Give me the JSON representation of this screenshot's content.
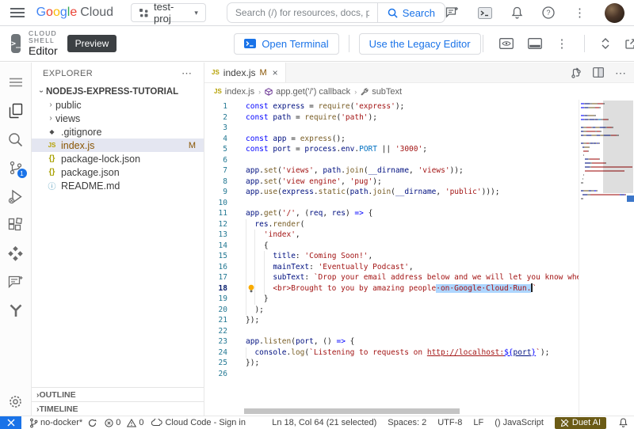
{
  "colors": {
    "accent_blue": "#1a73e8",
    "selection": "#add6ff",
    "git_modified": "#895503",
    "duet_badge_bg": "#6b5b16",
    "remote_indicator_bg": "#1a73e8",
    "preview_badge_bg": "#3c4043"
  },
  "topbar": {
    "brand_letters": [
      "G",
      "o",
      "o",
      "g",
      "l",
      "e"
    ],
    "brand_suffix": "Cloud",
    "project_name": "test-proj",
    "project_caret": "▾",
    "search_placeholder": "Search (/) for resources, docs, products, ...",
    "search_button_label": "Search",
    "more_glyph": "⋮"
  },
  "shell_header": {
    "eyebrow": "CLOUD SHELL",
    "title": "Editor",
    "shell_logo_glyph": ">_",
    "preview_badge": "Preview",
    "open_terminal_label": "Open Terminal",
    "legacy_editor_label": "Use the Legacy Editor",
    "more_glyph": "⋮",
    "close_glyph": "×"
  },
  "activity_bar": {
    "scm_badge": "1"
  },
  "sidebar": {
    "explorer_title": "EXPLORER",
    "more_glyph": "⋯",
    "root_label": "NODEJS-EXPRESS-TUTORIAL",
    "files": [
      {
        "label": "public"
      },
      {
        "label": "views"
      },
      {
        "label": ".gitignore",
        "glyph": "◆"
      },
      {
        "label": "index.js",
        "glyph": "JS",
        "badge": "M"
      },
      {
        "label": "package-lock.json",
        "glyph": "{}"
      },
      {
        "label": "package.json",
        "glyph": "{}"
      },
      {
        "label": "README.md",
        "glyph": "ⓘ"
      }
    ],
    "outline_label": "OUTLINE",
    "timeline_label": "TIMELINE"
  },
  "editor": {
    "tab": {
      "label": "index.js",
      "glyph": "JS",
      "modified": "M",
      "close_glyph": "×"
    },
    "tabbar_more_glyph": "⋯",
    "breadcrumb": {
      "file": "index.js",
      "file_glyph": "JS",
      "symbol": "app.get('/') callback",
      "member": "subText"
    },
    "code": {
      "lines": [
        {
          "n": 1,
          "ind": 0,
          "seg": [
            [
              "const",
              "kw"
            ],
            [
              " ",
              "pln"
            ],
            [
              "express",
              "var"
            ],
            [
              " = ",
              "pln"
            ],
            [
              "require",
              "fn"
            ],
            [
              "(",
              "pln"
            ],
            [
              "'express'",
              "str"
            ],
            [
              ");",
              "pln"
            ]
          ]
        },
        {
          "n": 2,
          "ind": 0,
          "seg": [
            [
              "const",
              "kw"
            ],
            [
              " ",
              "pln"
            ],
            [
              "path",
              "var"
            ],
            [
              " = ",
              "pln"
            ],
            [
              "require",
              "fn"
            ],
            [
              "(",
              "pln"
            ],
            [
              "'path'",
              "str"
            ],
            [
              ");",
              "pln"
            ]
          ]
        },
        {
          "n": 3,
          "ind": 0,
          "seg": []
        },
        {
          "n": 4,
          "ind": 0,
          "seg": [
            [
              "const",
              "kw"
            ],
            [
              " ",
              "pln"
            ],
            [
              "app",
              "var"
            ],
            [
              " = ",
              "pln"
            ],
            [
              "express",
              "fn"
            ],
            [
              "();",
              "pln"
            ]
          ]
        },
        {
          "n": 5,
          "ind": 0,
          "seg": [
            [
              "const",
              "kw"
            ],
            [
              " ",
              "pln"
            ],
            [
              "port",
              "var"
            ],
            [
              " = ",
              "pln"
            ],
            [
              "process",
              "var"
            ],
            [
              ".",
              "pln"
            ],
            [
              "env",
              "var"
            ],
            [
              ".",
              "pln"
            ],
            [
              "PORT",
              "cnst"
            ],
            [
              " || ",
              "pln"
            ],
            [
              "'3000'",
              "str"
            ],
            [
              ";",
              "pln"
            ]
          ]
        },
        {
          "n": 6,
          "ind": 0,
          "seg": []
        },
        {
          "n": 7,
          "ind": 0,
          "seg": [
            [
              "app",
              "var"
            ],
            [
              ".",
              "pln"
            ],
            [
              "set",
              "fn"
            ],
            [
              "(",
              "pln"
            ],
            [
              "'views'",
              "str"
            ],
            [
              ", ",
              "pln"
            ],
            [
              "path",
              "var"
            ],
            [
              ".",
              "pln"
            ],
            [
              "join",
              "fn"
            ],
            [
              "(",
              "pln"
            ],
            [
              "__dirname",
              "var"
            ],
            [
              ", ",
              "pln"
            ],
            [
              "'views'",
              "str"
            ],
            [
              "));",
              "pln"
            ]
          ]
        },
        {
          "n": 8,
          "ind": 0,
          "seg": [
            [
              "app",
              "var"
            ],
            [
              ".",
              "pln"
            ],
            [
              "set",
              "fn"
            ],
            [
              "(",
              "pln"
            ],
            [
              "'view engine'",
              "str"
            ],
            [
              ", ",
              "pln"
            ],
            [
              "'pug'",
              "str"
            ],
            [
              ");",
              "pln"
            ]
          ]
        },
        {
          "n": 9,
          "ind": 0,
          "seg": [
            [
              "app",
              "var"
            ],
            [
              ".",
              "pln"
            ],
            [
              "use",
              "fn"
            ],
            [
              "(",
              "pln"
            ],
            [
              "express",
              "var"
            ],
            [
              ".",
              "pln"
            ],
            [
              "static",
              "fn"
            ],
            [
              "(",
              "pln"
            ],
            [
              "path",
              "var"
            ],
            [
              ".",
              "pln"
            ],
            [
              "join",
              "fn"
            ],
            [
              "(",
              "pln"
            ],
            [
              "__dirname",
              "var"
            ],
            [
              ", ",
              "pln"
            ],
            [
              "'public'",
              "str"
            ],
            [
              ")));",
              "pln"
            ]
          ]
        },
        {
          "n": 10,
          "ind": 0,
          "seg": []
        },
        {
          "n": 11,
          "ind": 0,
          "seg": [
            [
              "app",
              "var"
            ],
            [
              ".",
              "pln"
            ],
            [
              "get",
              "fn"
            ],
            [
              "(",
              "pln"
            ],
            [
              "'/'",
              "str"
            ],
            [
              ", (",
              "pln"
            ],
            [
              "req",
              "var"
            ],
            [
              ", ",
              "pln"
            ],
            [
              "res",
              "var"
            ],
            [
              ") ",
              "pln"
            ],
            [
              "=>",
              "kw"
            ],
            [
              " {",
              "pln"
            ]
          ]
        },
        {
          "n": 12,
          "ind": 2,
          "seg": [
            [
              "res",
              "var"
            ],
            [
              ".",
              "pln"
            ],
            [
              "render",
              "fn"
            ],
            [
              "(",
              "pln"
            ]
          ]
        },
        {
          "n": 13,
          "ind": 4,
          "seg": [
            [
              "'index'",
              "str"
            ],
            [
              ",",
              "pln"
            ]
          ]
        },
        {
          "n": 14,
          "ind": 4,
          "seg": [
            [
              "{",
              "pln"
            ]
          ]
        },
        {
          "n": 15,
          "ind": 6,
          "seg": [
            [
              "title",
              "var"
            ],
            [
              ": ",
              "pln"
            ],
            [
              "'Coming Soon!'",
              "str"
            ],
            [
              ",",
              "pln"
            ]
          ]
        },
        {
          "n": 16,
          "ind": 6,
          "seg": [
            [
              "mainText",
              "var"
            ],
            [
              ": ",
              "pln"
            ],
            [
              "'Eventually Podcast'",
              "str"
            ],
            [
              ",",
              "pln"
            ]
          ]
        },
        {
          "n": 17,
          "ind": 6,
          "seg": [
            [
              "subText",
              "var"
            ],
            [
              ": ",
              "pln"
            ],
            [
              "`Drop your email address below and we will let you know when w",
              "str"
            ]
          ]
        },
        {
          "n": 18,
          "ind": 6,
          "active": true,
          "bulb": true,
          "seg": [
            [
              "<br>Brought to you by amazing people",
              "str"
            ],
            [
              " on Google Cloud Run.",
              "str sel ws"
            ],
            [
              "",
              "cursor"
            ],
            [
              "`",
              "str"
            ]
          ]
        },
        {
          "n": 19,
          "ind": 4,
          "seg": [
            [
              "}",
              "pln"
            ]
          ]
        },
        {
          "n": 20,
          "ind": 2,
          "seg": [
            [
              ");",
              "pln"
            ]
          ]
        },
        {
          "n": 21,
          "ind": 0,
          "seg": [
            [
              "});",
              "pln"
            ]
          ]
        },
        {
          "n": 22,
          "ind": 0,
          "seg": []
        },
        {
          "n": 23,
          "ind": 0,
          "seg": [
            [
              "app",
              "var"
            ],
            [
              ".",
              "pln"
            ],
            [
              "listen",
              "fn"
            ],
            [
              "(",
              "pln"
            ],
            [
              "port",
              "var"
            ],
            [
              ", () ",
              "pln"
            ],
            [
              "=>",
              "kw"
            ],
            [
              " {",
              "pln"
            ]
          ]
        },
        {
          "n": 24,
          "ind": 2,
          "seg": [
            [
              "console",
              "var"
            ],
            [
              ".",
              "pln"
            ],
            [
              "log",
              "fn"
            ],
            [
              "(",
              "pln"
            ],
            [
              "`Listening to requests on ",
              "str"
            ],
            [
              "http://localhost:",
              "str link"
            ],
            [
              "${",
              "kw link"
            ],
            [
              "port",
              "var link"
            ],
            [
              "}",
              "kw link"
            ],
            [
              "`",
              "str"
            ],
            [
              ");",
              "pln"
            ]
          ]
        },
        {
          "n": 25,
          "ind": 0,
          "seg": [
            [
              "});",
              "pln"
            ]
          ]
        },
        {
          "n": 26,
          "ind": 0,
          "seg": []
        }
      ]
    }
  },
  "statusbar": {
    "branch": "no-docker*",
    "errors": "0",
    "warnings": "0",
    "cloud_code": "Cloud Code - Sign in",
    "cursor_position": "Ln 18, Col 64 (21 selected)",
    "indentation": "Spaces: 2",
    "encoding": "UTF-8",
    "eol": "LF",
    "lang_glyph": "()",
    "language": "JavaScript",
    "duet_label": "Duet AI"
  }
}
